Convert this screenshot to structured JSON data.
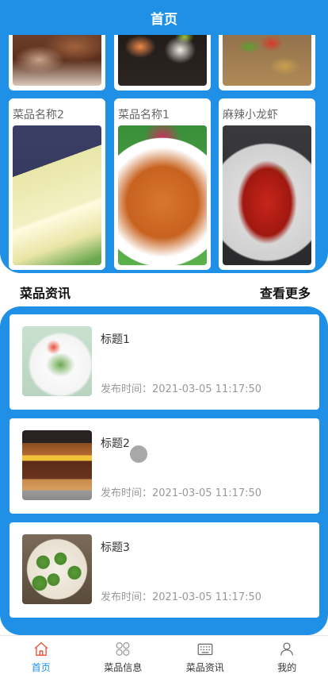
{
  "header": {
    "title": "首页"
  },
  "dishes": {
    "top_row": [
      {
        "image": "braised-meat-photo"
      },
      {
        "image": "sushi-photo"
      },
      {
        "image": "stir-fry-photo"
      }
    ],
    "bottom_row": [
      {
        "name": "菜品名称2",
        "image": "osmanthus-cake-photo"
      },
      {
        "name": "菜品名称1",
        "image": "stuffed-carrot-plate-photo"
      },
      {
        "name": "麻辣小龙虾",
        "image": "spicy-crayfish-photo"
      }
    ]
  },
  "section": {
    "title": "菜品资讯",
    "more": "查看更多"
  },
  "news": [
    {
      "title": "标题1",
      "time": "发布时间：2021-03-05 11:17:50",
      "image": "salad-plate-photo"
    },
    {
      "title": "标题2",
      "time": "发布时间：2021-03-05 11:17:50",
      "image": "burger-photo"
    },
    {
      "title": "标题3",
      "time": "发布时间：2021-03-05 11:17:50",
      "image": "green-dumplings-photo"
    }
  ],
  "tabbar": {
    "items": [
      {
        "label": "首页",
        "icon": "home-icon",
        "active": true
      },
      {
        "label": "菜品信息",
        "icon": "grid-icon",
        "active": false
      },
      {
        "label": "菜品资讯",
        "icon": "keyboard-icon",
        "active": false
      },
      {
        "label": "我的",
        "icon": "user-icon",
        "active": false
      }
    ]
  },
  "colors": {
    "primary": "#1f90e6",
    "tab_active": "#1f90e6",
    "text_muted": "#999999"
  }
}
